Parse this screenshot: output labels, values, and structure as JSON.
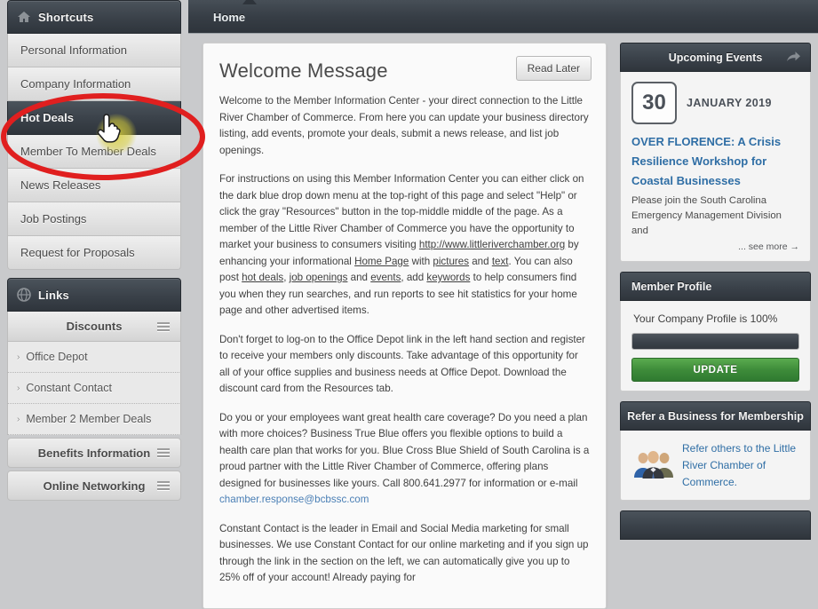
{
  "sidebar": {
    "shortcuts": {
      "title": "Shortcuts",
      "icon": "home-icon",
      "items": [
        {
          "label": "Personal Information",
          "active": false
        },
        {
          "label": "Company Information",
          "active": false
        },
        {
          "label": "Hot Deals",
          "active": true
        },
        {
          "label": "Member To Member Deals",
          "active": false
        },
        {
          "label": "News Releases",
          "active": false
        },
        {
          "label": "Job Postings",
          "active": false
        },
        {
          "label": "Request for Proposals",
          "active": false
        }
      ]
    },
    "links": {
      "title": "Links",
      "icon": "globe-icon",
      "groups": [
        {
          "label": "Discounts",
          "icon": "hamburger-icon",
          "items": [
            {
              "label": "Office Depot"
            },
            {
              "label": "Constant Contact"
            },
            {
              "label": "Member 2 Member Deals"
            }
          ]
        },
        {
          "label": "Benefits Information",
          "icon": "hamburger-icon",
          "items": []
        },
        {
          "label": "Online Networking",
          "icon": "hamburger-icon",
          "items": []
        }
      ]
    }
  },
  "tabs": {
    "active": "Home"
  },
  "welcome": {
    "title": "Welcome Message",
    "read_later_label": "Read Later",
    "paragraphs": [
      {
        "parts": [
          {
            "t": "Welcome to the Member Information Center - your direct connection to the Little River Chamber of Commerce.  From here you can update your business directory listing, add events, promote your deals, submit a news release, and list job openings."
          }
        ]
      },
      {
        "parts": [
          {
            "t": "For instructions on using this Member Information Center you can either click on the dark blue drop down menu at the top-right of this page and select \"Help\" or click the gray \"Resources\" button in the top-middle middle of the page. As a member of the Little River Chamber of Commerce you have the opportunity to market your business to consumers visiting "
          },
          {
            "t": "http://www.littleriverchamber.org",
            "link": true
          },
          {
            "t": " by enhancing your informational "
          },
          {
            "t": "Home Page",
            "link": true
          },
          {
            "t": " with "
          },
          {
            "t": "pictures",
            "link": true
          },
          {
            "t": " and "
          },
          {
            "t": "text",
            "link": true
          },
          {
            "t": ". You can also post "
          },
          {
            "t": "hot deals",
            "link": true
          },
          {
            "t": ", "
          },
          {
            "t": "job openings",
            "link": true
          },
          {
            "t": " and "
          },
          {
            "t": "events",
            "link": true
          },
          {
            "t": ", add "
          },
          {
            "t": "keywords",
            "link": true
          },
          {
            "t": " to help consumers find you when they run searches, and run reports to see hit statistics for your home page and other advertised items."
          }
        ]
      },
      {
        "parts": [
          {
            "t": "Don't forget to log-on to the Office Depot link in the left hand section and register to receive your members only discounts.  Take advantage of this opportunity for all of your office supplies and business needs at Office Depot. Download the discount card from the Resources tab."
          }
        ]
      },
      {
        "parts": [
          {
            "t": "Do you or your employees want great health care coverage?  Do you need a plan with more choices?  Business True Blue offers you flexible options to build a health care plan that works for you.  Blue Cross Blue Shield of South Carolina is a proud partner with the Little River Chamber of Commerce, offering plans designed for businesses like yours.  Call 800.641.2977 for information or e-mail "
          },
          {
            "t": "chamber.response@bcbssc.com",
            "blue": true
          }
        ]
      },
      {
        "parts": [
          {
            "t": "Constant Contact is the leader in Email and Social Media marketing for small businesses. We use Constant Contact for our online marketing and if you sign up through the link in the section on the left, we can automatically give you up to 25% off of your account! Already paying for"
          }
        ]
      }
    ]
  },
  "rail": {
    "events": {
      "title": "Upcoming Events",
      "share_icon": "share-arrow-icon",
      "day": "30",
      "month_year": "JANUARY 2019",
      "event_title": "OVER FLORENCE: A Crisis Resilience Workshop for Coastal Businesses",
      "event_desc": "Please join the South Carolina Emergency Management Division and",
      "see_more": "... see more →"
    },
    "profile": {
      "title": "Member Profile",
      "status_text": "Your Company Profile is 100%",
      "percent": 100,
      "update_label": "UPDATE"
    },
    "refer": {
      "title": "Refer a Business for Membership",
      "icon": "people-group-icon",
      "text": "Refer others to the Little River Chamber of Commerce."
    }
  },
  "annotation": {
    "highlight_color": "#e01f1f",
    "cursor": "hand-pointer-cursor",
    "highlight_glow": "#d6cd3c"
  }
}
